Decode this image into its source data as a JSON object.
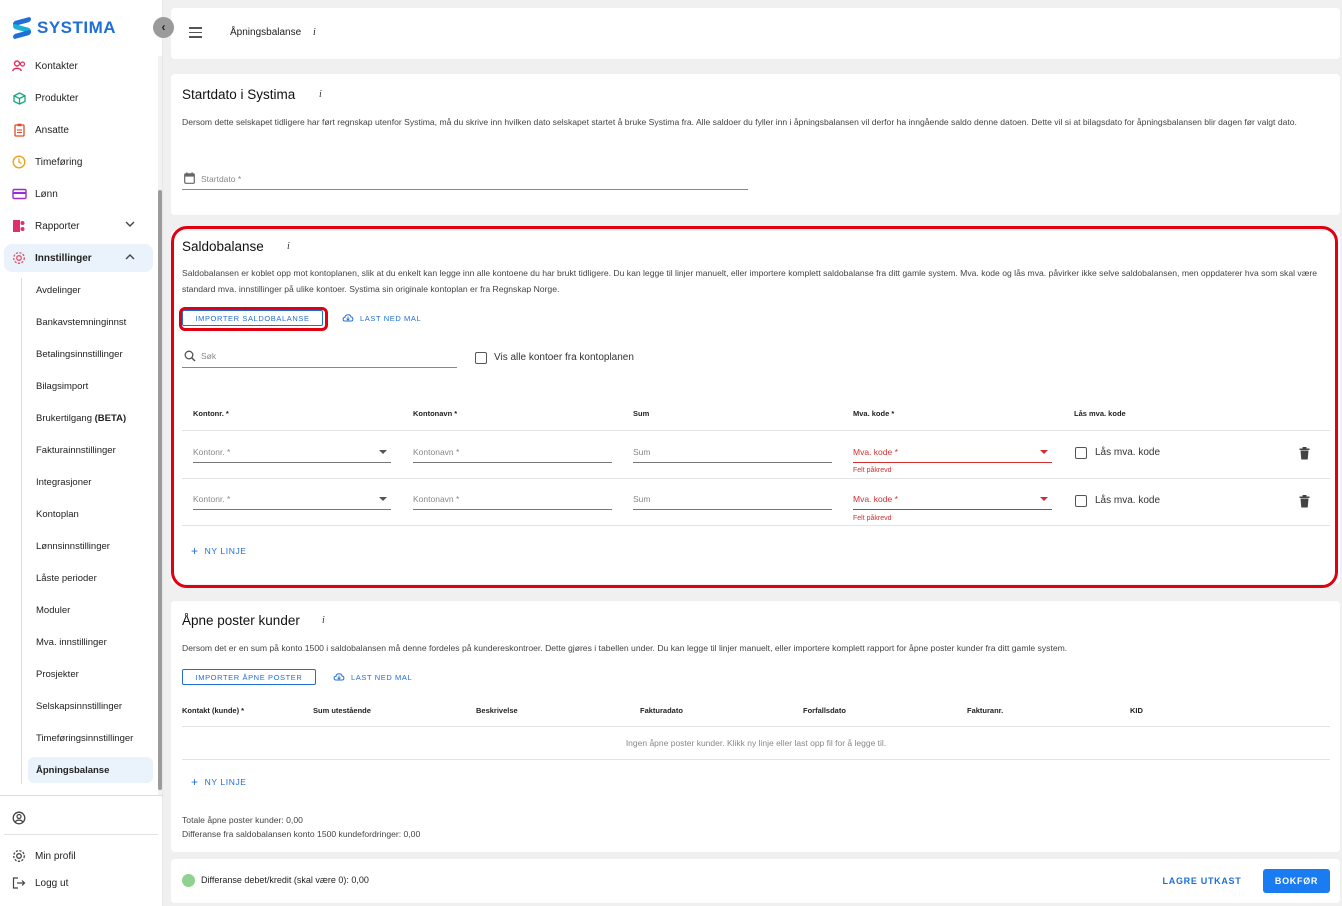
{
  "app": {
    "logo_text": "SYSTIMA",
    "accent": "#1f6fd6",
    "error_color": "#d32f2f"
  },
  "sidebar": {
    "items": [
      {
        "label": "Kontakter",
        "icon": "contacts-icon"
      },
      {
        "label": "Produkter",
        "icon": "cube-icon"
      },
      {
        "label": "Ansatte",
        "icon": "badge-icon"
      },
      {
        "label": "Timeføring",
        "icon": "clock-icon"
      },
      {
        "label": "Lønn",
        "icon": "card-icon"
      },
      {
        "label": "Rapporter",
        "icon": "report-icon"
      },
      {
        "label": "Innstillinger",
        "icon": "gear-icon"
      }
    ],
    "sub_items": [
      "Avdelinger",
      "Bankavstemninginnst",
      "Betalingsinnstillinger",
      "Bilagsimport",
      "Brukertilgang",
      "Fakturainnstillinger",
      "Integrasjoner",
      "Kontoplan",
      "Lønnsinnstillinger",
      "Låste perioder",
      "Moduler",
      "Mva. innstillinger",
      "Prosjekter",
      "Selskapsinnstillinger",
      "Timeføringsinnstillinger",
      "Åpningsbalanse"
    ],
    "beta_tag": "(BETA)",
    "bottom": [
      {
        "label": "Min profil",
        "icon": "gear-icon"
      },
      {
        "label": "Logg ut",
        "icon": "logout-icon"
      }
    ]
  },
  "header": {
    "title": "Åpningsbalanse",
    "info": "i"
  },
  "start": {
    "title": "Startdato i Systima",
    "info": "i",
    "description": "Dersom dette selskapet tidligere har ført regnskap utenfor Systima, må du skrive inn hvilken dato selskapet startet å bruke Systima fra. Alle saldoer du fyller inn i åpningsbalansen vil derfor ha inngående saldo denne datoen. Dette vil si at bilagsdato for åpningsbalansen blir dagen før valgt dato.",
    "date_placeholder": "Startdato *"
  },
  "saldo": {
    "title": "Saldobalanse",
    "info": "i",
    "description": "Saldobalansen er koblet opp mot kontoplanen, slik at du enkelt kan legge inn alle kontoene du har brukt tidligere. Du kan legge til linjer manuelt, eller importere komplett saldobalanse fra ditt gamle system. Mva. kode og lås mva. påvirker ikke selve saldobalansen, men oppdaterer hva som skal være standard mva. innstillinger på ulike kontoer. Systima sin originale kontoplan er fra Regnskap Norge.",
    "import_label": "Importer saldobalanse",
    "download_label": "Last ned mal",
    "search_placeholder": "Søk",
    "show_all_label": "Vis alle kontoer fra kontoplanen",
    "columns": [
      "Kontonr. *",
      "Kontonavn *",
      "Sum",
      "Mva. kode *",
      "Lås mva. kode"
    ],
    "rows": [
      {
        "kontonr": "Kontonr. *",
        "kontonavn": "Kontonavn *",
        "sum": "Sum",
        "mva": "Mva. kode *",
        "mva_error": "Felt påkrevd",
        "lock_label": "Lås mva. kode"
      },
      {
        "kontonr": "Kontonr. *",
        "kontonavn": "Kontonavn *",
        "sum": "Sum",
        "mva": "Mva. kode *",
        "mva_error": "Felt påkrevd",
        "lock_label": "Lås mva. kode"
      }
    ],
    "add_line_label": "Ny linje"
  },
  "apne": {
    "title": "Åpne poster kunder",
    "info": "i",
    "description": "Dersom det er en sum på konto 1500 i saldobalansen må denne fordeles på kundereskontroer. Dette gjøres i tabellen under. Du kan legge til linjer manuelt, eller importere komplett rapport for åpne poster kunder fra ditt gamle system.",
    "import_label": "Importer åpne poster",
    "download_label": "Last ned mal",
    "columns": [
      "Kontakt (kunde) *",
      "Sum utestående",
      "Beskrivelse",
      "Fakturadato",
      "Forfallsdato",
      "Fakturanr.",
      "KID"
    ],
    "empty_text": "Ingen åpne poster kunder. Klikk ny linje eller last opp fil for å legge til.",
    "add_line_label": "Ny linje",
    "total_text": "Totale åpne poster kunder: 0,00",
    "diff_text": "Differanse fra saldobalansen konto 1500 kundefordringer: 0,00"
  },
  "footer": {
    "status": "Differanse debet/kredit (skal være 0): 0,00",
    "save_draft": "LAGRE UTKAST",
    "post": "BOKFØR"
  }
}
